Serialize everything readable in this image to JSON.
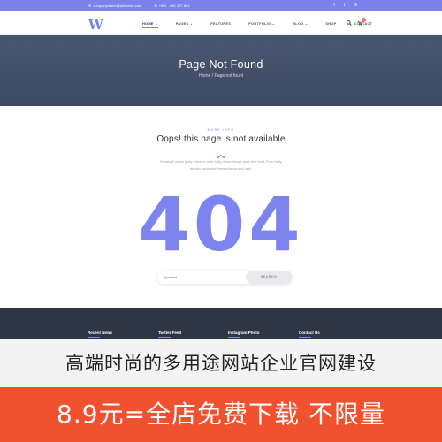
{
  "topbar": {
    "email": "companyname@wthemes.com",
    "phone": "+001 - 061 227 851",
    "social": [
      "f",
      "t",
      "G"
    ]
  },
  "nav": {
    "logo": "W",
    "items": [
      {
        "label": "HOME",
        "chevron": true
      },
      {
        "label": "PAGES",
        "chevron": true
      },
      {
        "label": "FEATURES",
        "chevron": false
      },
      {
        "label": "PORTFOLIO",
        "chevron": true
      },
      {
        "label": "BLOG",
        "chevron": true
      },
      {
        "label": "SHOP",
        "chevron": false
      },
      {
        "label": "CONTACT",
        "chevron": false
      }
    ],
    "cart_count": "0"
  },
  "hero": {
    "title": "Page Not Found",
    "breadcrumb_home": "Home",
    "breadcrumb_sep": "/",
    "breadcrumb_current": "Page not fount"
  },
  "content": {
    "eyebrow": "MORE INFO",
    "heading": "Oops! this page is not available",
    "description": "Meatball chuck jerky chicken pork belly doner ribeye pork loin beef. Pork belly boudin turducken bresaola corned beef.",
    "code": "404",
    "search_placeholder": "Type text",
    "search_button": "SEARCH"
  },
  "footer": {
    "columns": [
      "Recent News",
      "Twitter Feed",
      "Instagram Photo",
      "Contact Us"
    ]
  },
  "promo": {
    "line1": "高端时尚的多用途网站企业官网建设",
    "line2": "8.9元=全店免费下载  不限量"
  },
  "colors": {
    "accent": "#7b82ee",
    "hero_bg": "#44506a",
    "footer_bg": "#2e3646",
    "promo_bg": "#f2512f"
  }
}
